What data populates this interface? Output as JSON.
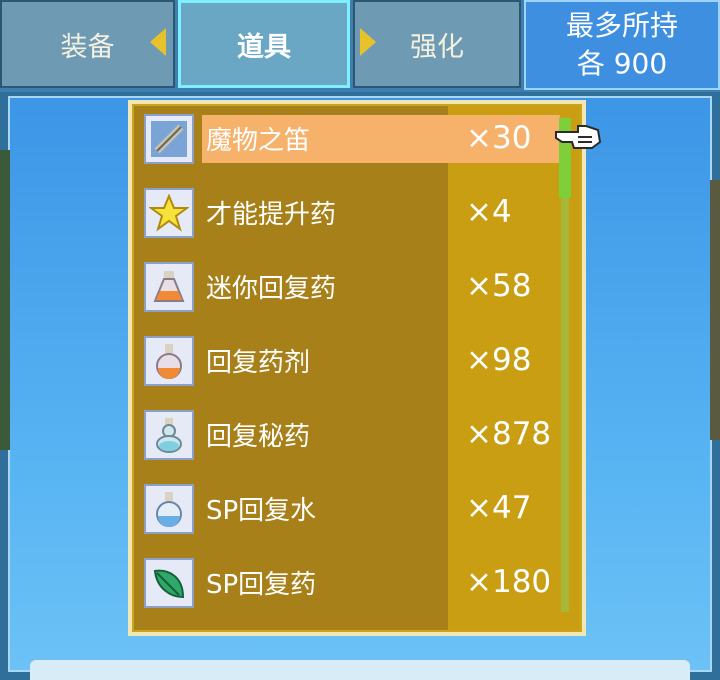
{
  "tabs": {
    "equip": "装备",
    "items": "道具",
    "enhance": "强化"
  },
  "max_hold": {
    "line1": "最多所持",
    "line2": "各 900"
  },
  "items": [
    {
      "name": "魔物之笛",
      "qty": "×30",
      "icon": "flute-icon",
      "selected": true
    },
    {
      "name": "才能提升药",
      "qty": "×4",
      "icon": "star-icon",
      "selected": false
    },
    {
      "name": "迷你回复药",
      "qty": "×58",
      "icon": "small-potion-icon",
      "selected": false
    },
    {
      "name": "回复药剂",
      "qty": "×98",
      "icon": "orange-potion-icon",
      "selected": false
    },
    {
      "name": "回复秘药",
      "qty": "×878",
      "icon": "secret-potion-icon",
      "selected": false
    },
    {
      "name": "SP回复水",
      "qty": "×47",
      "icon": "blue-potion-icon",
      "selected": false
    },
    {
      "name": "SP回复药",
      "qty": "×180",
      "icon": "leaf-icon",
      "selected": false
    }
  ],
  "colors": {
    "highlight": "#f6b26b",
    "list_bg": "#a8801a",
    "qty_column_bg": "#c99e12",
    "tab_active_border": "#7ff0ff"
  }
}
